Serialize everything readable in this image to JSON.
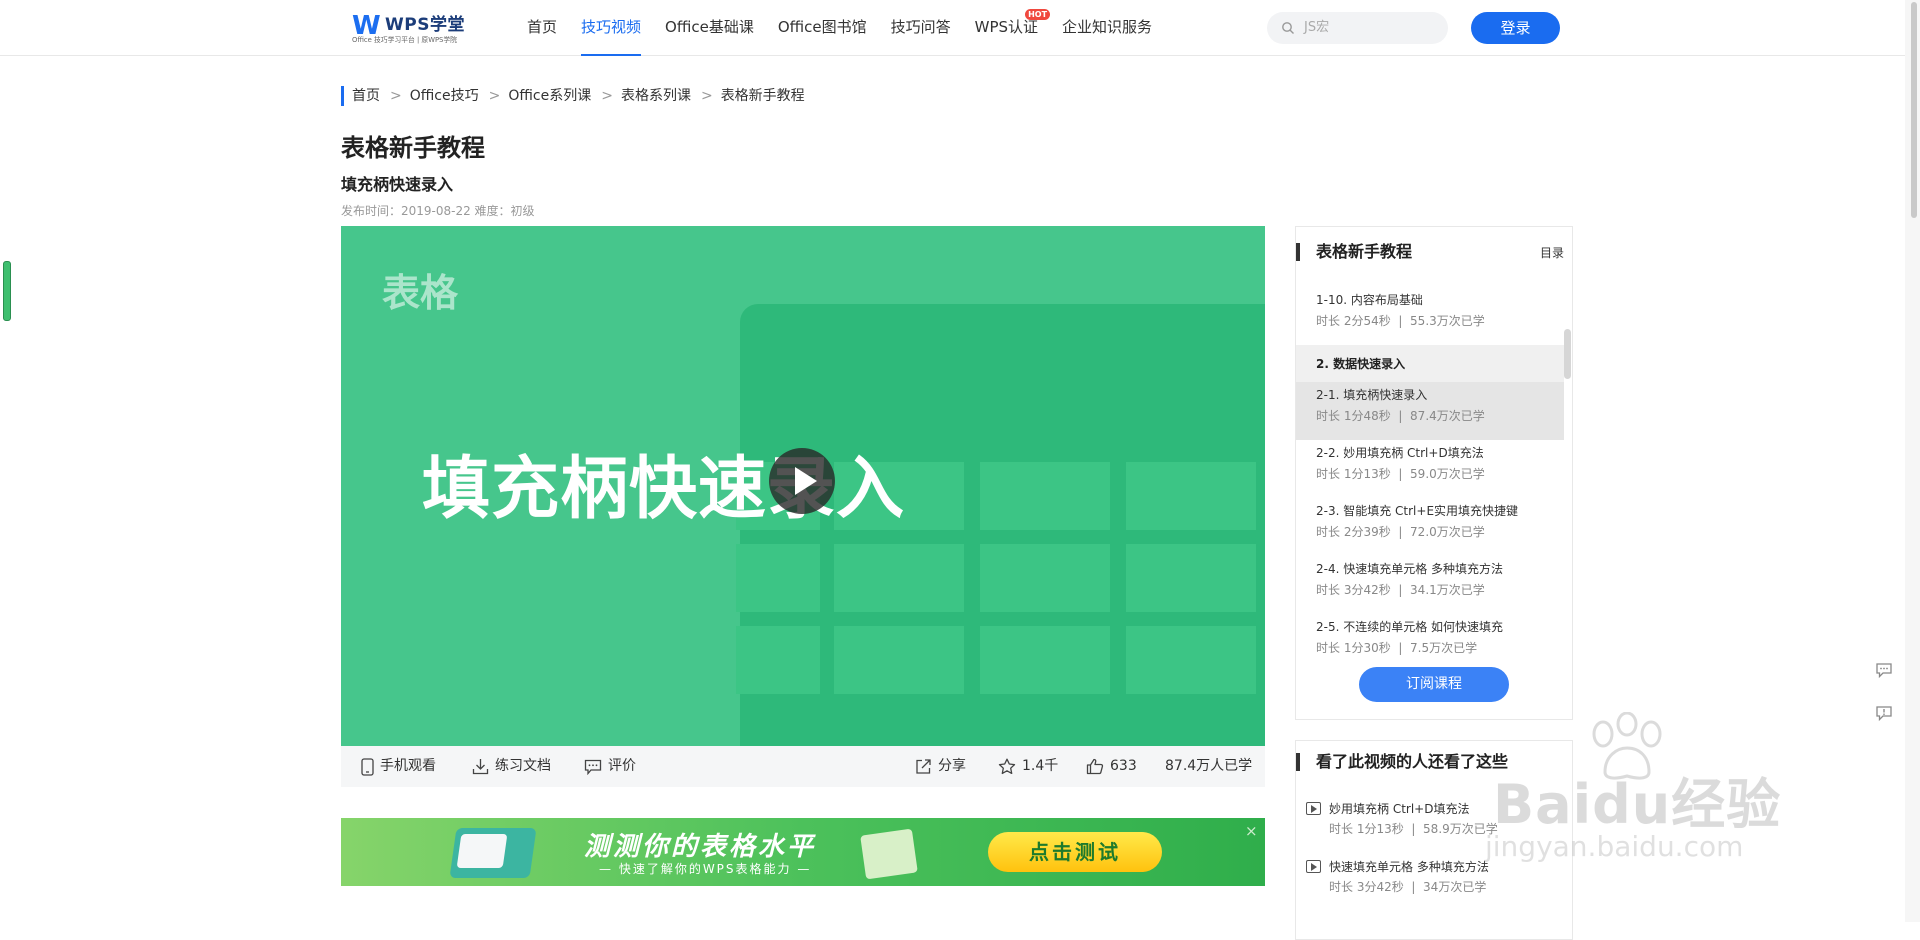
{
  "header": {
    "logo": {
      "brand": "WPS学堂",
      "tagline": "Office 技巧学习平台 | 原WPS学院"
    },
    "nav": [
      {
        "label": "首页"
      },
      {
        "label": "技巧视频",
        "active": true
      },
      {
        "label": "Office基础课"
      },
      {
        "label": "Office图书馆"
      },
      {
        "label": "技巧问答"
      },
      {
        "label": "WPS认证",
        "badge": "HOT"
      },
      {
        "label": "企业知识服务"
      }
    ],
    "search": {
      "placeholder": "JS宏"
    },
    "login_label": "登录"
  },
  "breadcrumb": [
    "首页",
    "Office技巧",
    "Office系列课",
    "表格系列课",
    "表格新手教程"
  ],
  "page": {
    "title": "表格新手教程",
    "subtitle": "填充柄快速录入",
    "meta": "发布时间：2019-08-22 难度：初级"
  },
  "video": {
    "category_label": "表格",
    "title_overlay": "填充柄快速录入"
  },
  "actions": {
    "mobile": "手机观看",
    "docs": "练习文档",
    "comment": "评价",
    "share": "分享",
    "favorite_count": "1.4千",
    "like_count": "633",
    "learners": "87.4万人已学"
  },
  "banner": {
    "title": "测测你的表格水平",
    "subtitle": "— 快速了解你的WPS表格能力 —",
    "button": "点击测试",
    "close": "×"
  },
  "course_panel": {
    "title": "表格新手教程",
    "toc_label": "目录",
    "lessons_before": [
      {
        "title": "1-10. 内容布局基础",
        "duration": "时长 2分54秒",
        "learners": "55.3万次已学"
      }
    ],
    "chapter": "2. 数据快速录入",
    "lessons": [
      {
        "title": "2-1. 填充柄快速录入",
        "duration": "时长 1分48秒",
        "learners": "87.4万次已学",
        "current": true
      },
      {
        "title": "2-2. 妙用填充柄 Ctrl+D填充法",
        "duration": "时长 1分13秒",
        "learners": "59.0万次已学"
      },
      {
        "title": "2-3. 智能填充 Ctrl+E实用填充快捷键",
        "duration": "时长 2分39秒",
        "learners": "72.0万次已学"
      },
      {
        "title": "2-4. 快速填充单元格 多种填充方法",
        "duration": "时长 3分42秒",
        "learners": "34.1万次已学"
      },
      {
        "title": "2-5. 不连续的单元格 如何快速填充",
        "duration": "时长 1分30秒",
        "learners": "7.5万次已学"
      }
    ],
    "subscribe_label": "订阅课程"
  },
  "recommend": {
    "title": "看了此视频的人还看了这些",
    "items": [
      {
        "title": "妙用填充柄 Ctrl+D填充法",
        "duration": "时长 1分13秒",
        "learners": "58.9万次已学"
      },
      {
        "title": "快速填充单元格 多种填充方法",
        "duration": "时长 3分42秒",
        "learners": "34万次已学"
      }
    ]
  },
  "watermark": {
    "text": "Baidu经验",
    "url": "jingyan.baidu.com"
  },
  "colors": {
    "accent": "#1a6cf0",
    "video_green": "#46c68c",
    "hot_red": "#f0483e"
  }
}
